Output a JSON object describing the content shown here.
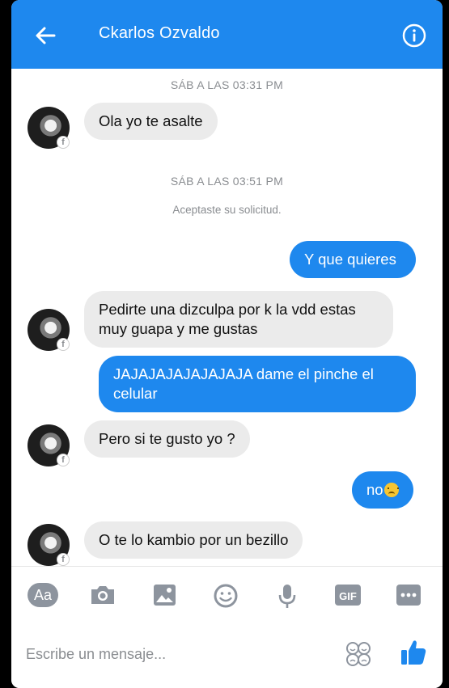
{
  "header": {
    "contact_name": "Ckarlos Ozvaldo",
    "back_icon": "arrow-left-icon",
    "info_icon": "info-icon",
    "color": "#1e88ee"
  },
  "chat": {
    "items": [
      {
        "type": "timestamp",
        "text": "SÁB A LAS 03:31 PM"
      },
      {
        "type": "incoming",
        "text": "Ola yo te asalte"
      },
      {
        "type": "timestamp",
        "text": "SÁB A LAS 03:51 PM"
      },
      {
        "type": "system",
        "text": "Aceptaste su solicitud."
      },
      {
        "type": "outgoing",
        "text": "Y que quieres"
      },
      {
        "type": "incoming",
        "text": "Pedirte una dizculpa por k la vdd estas muy guapa y me gustas"
      },
      {
        "type": "outgoing",
        "text": "JAJAJAJAJAJAJAJA dame el pinche el celular"
      },
      {
        "type": "incoming",
        "text": "Pero si te gusto yo ?"
      },
      {
        "type": "outgoing",
        "text": "no",
        "emoji": "disappointed-face-emoji"
      },
      {
        "type": "incoming",
        "text": "O te lo kambio por un bezillo"
      }
    ]
  },
  "toolbar": {
    "aa_label": "Aa",
    "gif_label": "GIF",
    "icons": [
      "text-format-icon",
      "camera-icon",
      "gallery-icon",
      "emoji-icon",
      "microphone-icon",
      "gif-icon",
      "more-icon"
    ]
  },
  "composer": {
    "placeholder": "Escribe un mensaje...",
    "stickers_icon": "stickers-icon",
    "like_icon": "thumbs-up-icon"
  }
}
